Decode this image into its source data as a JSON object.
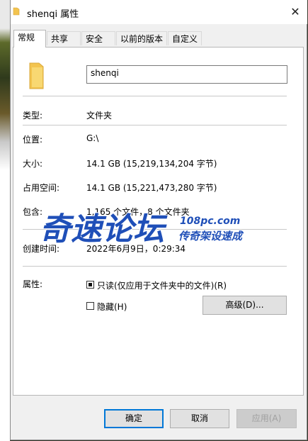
{
  "window": {
    "title": "shenqi 属性",
    "close_glyph": "✕"
  },
  "tabs": [
    {
      "label": "常规",
      "active": true
    },
    {
      "label": "共享",
      "active": false
    },
    {
      "label": "安全",
      "active": false
    },
    {
      "label": "以前的版本",
      "active": false
    },
    {
      "label": "自定义",
      "active": false
    }
  ],
  "general": {
    "folder_name": "shenqi",
    "rows": [
      {
        "label": "类型:",
        "value": "文件夹"
      },
      {
        "label": "位置:",
        "value": "G:\\"
      },
      {
        "label": "大小:",
        "value": "14.1 GB (15,219,134,204 字节)"
      },
      {
        "label": "占用空间:",
        "value": "14.1 GB (15,221,473,280 字节)"
      },
      {
        "label": "包含:",
        "value": "1,165 个文件，8 个文件夹"
      },
      {
        "label": "创建时间:",
        "value": "2022年6月9日，0:29:34"
      }
    ],
    "attributes_label": "属性:",
    "readonly_label": "只读(仅应用于文件夹中的文件)(R)",
    "hidden_label": "隐藏(H)",
    "advanced_label": "高级(D)..."
  },
  "footer": {
    "ok_label": "确定",
    "cancel_label": "取消",
    "apply_label": "应用(A)"
  },
  "watermark": {
    "main": "奇速论坛",
    "domain": "108pc.com",
    "slogan": "传奇架设速成"
  },
  "icons": {
    "title_icon": "folder-icon",
    "large_icon": "folder-icon",
    "close_icon": "close-icon"
  },
  "colors": {
    "focus_blue": "#0078d7",
    "watermark_blue": "#1f4fb8",
    "folder_yellow": "#f3c44f"
  }
}
